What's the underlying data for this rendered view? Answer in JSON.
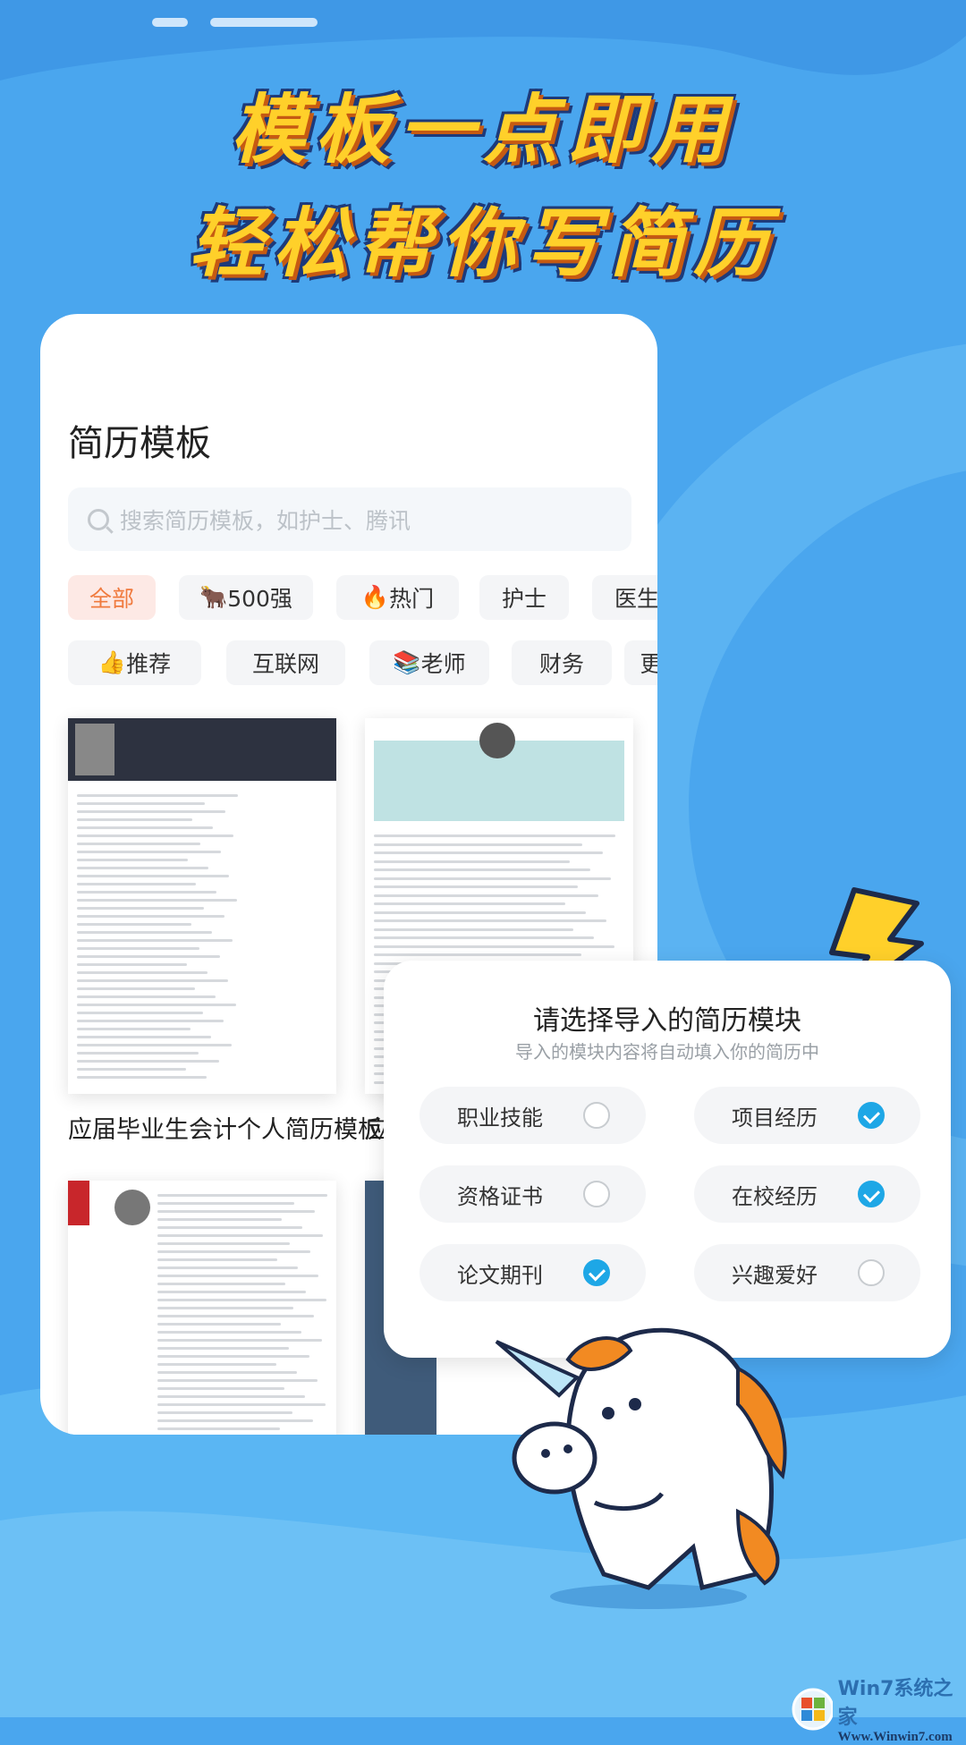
{
  "headline": {
    "line1": "模板一点即用",
    "line2": "轻松帮你写简历"
  },
  "panel": {
    "title": "简历模板",
    "search": {
      "placeholder": "搜索简历模板，如护士、腾讯",
      "icon": "search-icon"
    },
    "chips_row1": [
      {
        "label": "全部",
        "emoji": "",
        "active": true
      },
      {
        "label": "500强",
        "emoji": "🐂",
        "active": false
      },
      {
        "label": "热门",
        "emoji": "🔥",
        "active": false
      },
      {
        "label": "护士",
        "emoji": "",
        "active": false
      },
      {
        "label": "医生",
        "emoji": "",
        "active": false
      }
    ],
    "chips_row2": [
      {
        "label": "推荐",
        "emoji": "👍",
        "active": false
      },
      {
        "label": "互联网",
        "emoji": "",
        "active": false
      },
      {
        "label": "老师",
        "emoji": "📚",
        "active": false
      },
      {
        "label": "财务",
        "emoji": "",
        "active": false
      },
      {
        "label": "更",
        "emoji": "",
        "active": false
      }
    ],
    "templates": [
      {
        "caption": "应届毕业生会计个人简历模板"
      },
      {
        "caption": "应"
      }
    ]
  },
  "dialog": {
    "title": "请选择导入的简历模块",
    "subtitle": "导入的模块内容将自动填入你的简历中",
    "options": [
      {
        "label": "职业技能",
        "checked": false
      },
      {
        "label": "项目经历",
        "checked": true
      },
      {
        "label": "资格证书",
        "checked": false
      },
      {
        "label": "在校经历",
        "checked": true
      },
      {
        "label": "论文期刊",
        "checked": true
      },
      {
        "label": "兴趣爱好",
        "checked": false
      }
    ]
  },
  "watermark": {
    "brand": "Win7系统之家",
    "url": "Www.Winwin7.com"
  },
  "colors": {
    "background": "#4aa6ee",
    "headline": "#ffd02a",
    "accent_chip": "#f07a3e",
    "checkbox": "#1ea7e6"
  }
}
